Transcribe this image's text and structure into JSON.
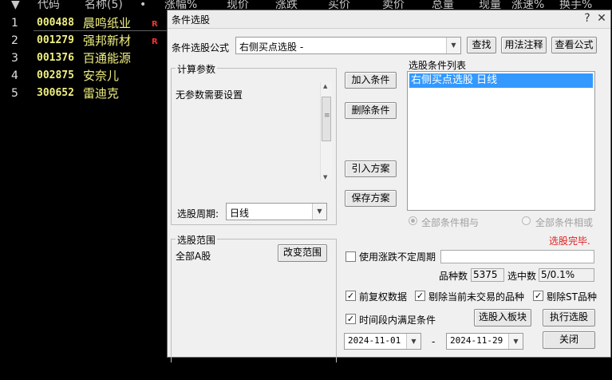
{
  "list": {
    "headers": [
      "代码",
      "名称(5)",
      "•",
      "涨幅%",
      "现价",
      "涨跌",
      "买价",
      "卖价",
      "总量",
      "现量",
      "涨速%",
      "换手%"
    ],
    "sort_arrow": "▼",
    "rows": [
      {
        "idx": "1",
        "code": "000488",
        "name": "晨鸣纸业",
        "flag": "R"
      },
      {
        "idx": "2",
        "code": "001279",
        "name": "强邦新材",
        "flag": "R"
      },
      {
        "idx": "3",
        "code": "001376",
        "name": "百通能源",
        "flag": ""
      },
      {
        "idx": "4",
        "code": "002875",
        "name": "安奈儿",
        "flag": ""
      },
      {
        "idx": "5",
        "code": "300652",
        "name": "雷迪克",
        "flag": ""
      }
    ]
  },
  "dialog": {
    "title": "条件选股",
    "title_buttons": {
      "help": "?",
      "close": "✕"
    },
    "formula_label": "条件选股公式",
    "formula_value": "右侧买点选股 -",
    "btn_find": "查找",
    "btn_usage": "用法注释",
    "btn_view_formula": "查看公式",
    "params_group": "计算参数",
    "params_text": "无参数需要设置",
    "period_label": "选股周期:",
    "period_value": "日线",
    "btn_add": "加入条件",
    "btn_delete": "删除条件",
    "btn_import": "引入方案",
    "btn_save": "保存方案",
    "cond_list_label": "选股条件列表",
    "cond_items": [
      "右侧买点选股  日线"
    ],
    "radio_and": "全部条件相与",
    "radio_or": "全部条件相或",
    "status": "选股完毕.",
    "range_group": "选股范围",
    "range_value": "全部A股",
    "btn_change_range": "改变范围",
    "use_period_label": "使用涨跌不定周期",
    "use_period_checked": false,
    "count_label": "品种数",
    "count_value": "5375",
    "selected_label": "选中数",
    "selected_value": "5/0.1%",
    "opt_fq": "前复权数据",
    "opt_fq_checked": true,
    "opt_exclude_untraded": "剔除当前未交易的品种",
    "opt_exclude_untraded_checked": true,
    "opt_exclude_st": "剔除ST品种",
    "opt_exclude_st_checked": true,
    "opt_time_range": "时间段内满足条件",
    "opt_time_range_checked": true,
    "btn_to_block": "选股入板块",
    "btn_execute": "执行选股",
    "date_from": "2024-11-01",
    "date_sep": "-",
    "date_to": "2024-11-29",
    "btn_close": "关闭",
    "status_color": "#e02020",
    "highlight_color": "#3399ff"
  }
}
